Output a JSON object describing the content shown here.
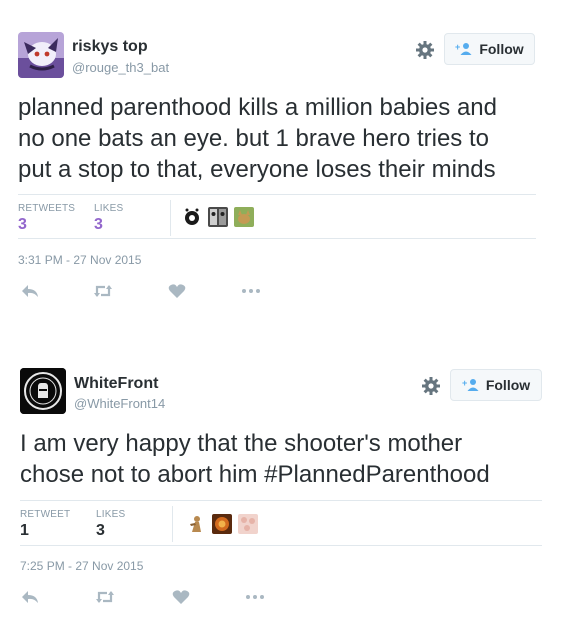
{
  "tweets": [
    {
      "name": "riskys top",
      "handle": "@rouge_th3_bat",
      "follow_label": "Follow",
      "text_lines": [
        "planned parenthood kills a million babies and",
        "no one bats an eye. but 1 brave hero tries to",
        "put a stop to that, everyone loses their minds"
      ],
      "retweets_label": "RETWEETS",
      "retweets_count": "3",
      "likes_label": "LIKES",
      "likes_count": "3",
      "timestamp": "3:31 PM - 27 Nov 2015",
      "count_color": "#9266cc"
    },
    {
      "name": "WhiteFront",
      "handle": "@WhiteFront14",
      "follow_label": "Follow",
      "text_lines": [
        "I am very happy that the shooter's mother",
        "chose not to abort him #PlannedParenthood"
      ],
      "retweets_label": "RETWEET",
      "retweets_count": "1",
      "likes_label": "LIKES",
      "likes_count": "3",
      "timestamp": "7:25 PM - 27 Nov 2015",
      "count_color": "#292f33"
    }
  ],
  "icons": {
    "gear": "gear-icon",
    "follow": "add-person-icon",
    "reply": "reply-icon",
    "retweet": "retweet-icon",
    "like": "heart-icon",
    "more": "more-icon"
  },
  "colors": {
    "icon_gray": "#aab8c2",
    "follow_blue": "#55acee",
    "divider": "#e1e8ed"
  }
}
